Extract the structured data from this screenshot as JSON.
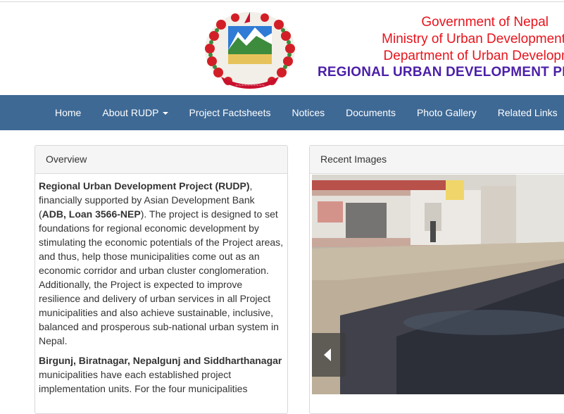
{
  "header": {
    "gov_line1": "Government of Nepal",
    "gov_line2": "Ministry of Urban Development",
    "gov_line3": "Department of Urban Development and Building Construction",
    "project_title": "REGIONAL URBAN DEVELOPMENT PROJECT"
  },
  "nav": {
    "items": [
      {
        "label": "Home"
      },
      {
        "label": "About RUDP"
      },
      {
        "label": "Project Factsheets"
      },
      {
        "label": "Notices"
      },
      {
        "label": "Documents"
      },
      {
        "label": "Photo Gallery"
      },
      {
        "label": "Related Links"
      }
    ]
  },
  "overview": {
    "heading": "Overview",
    "p1_bold1": "Regional Urban Development Project (RUDP)",
    "p1_text1": ", financially supported by Asian Development Bank (",
    "p1_bold2": "ADB, Loan 3566-NEP",
    "p1_text2": "). The project is designed to set foundations for regional economic development by stimulating the economic potentials of the Project areas, and thus, help those municipalities come out as an economic corridor and urban cluster conglomeration. Additionally, the Project is expected to improve resilience and delivery of urban services in all Project municipalities and also achieve sustainable, inclusive, balanced and prosperous sub-national urban system in Nepal.",
    "p2_bold": "Birgunj, Biratnagar,  Nepalgunj  and Siddharthanagar",
    "p2_text": "  municipalities have each established project implementation units. For the four municipalities"
  },
  "recent": {
    "heading": "Recent Images"
  },
  "colors": {
    "navbar": "#3e6995",
    "gov_text": "#e8141c",
    "project_title": "#4b1fa8"
  }
}
